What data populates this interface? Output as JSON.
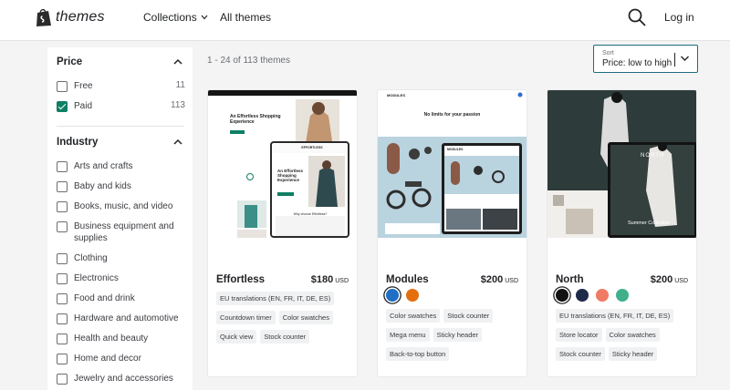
{
  "header": {
    "brand": "themes",
    "nav": {
      "collections": "Collections",
      "all_themes": "All themes"
    },
    "login": "Log in"
  },
  "sidebar": {
    "price": {
      "title": "Price",
      "items": [
        {
          "label": "Free",
          "count": "11",
          "checked": false
        },
        {
          "label": "Paid",
          "count": "113",
          "checked": true
        }
      ]
    },
    "industry": {
      "title": "Industry",
      "items": [
        {
          "label": "Arts and crafts"
        },
        {
          "label": "Baby and kids"
        },
        {
          "label": "Books, music, and video"
        },
        {
          "label": "Business equipment and supplies"
        },
        {
          "label": "Clothing"
        },
        {
          "label": "Electronics"
        },
        {
          "label": "Food and drink"
        },
        {
          "label": "Hardware and automotive"
        },
        {
          "label": "Health and beauty"
        },
        {
          "label": "Home and decor"
        },
        {
          "label": "Jewelry and accessories"
        }
      ]
    }
  },
  "results": {
    "count_text": "1 - 24 of 113 themes",
    "sort": {
      "caption": "Sort",
      "value": "Price: low to high"
    }
  },
  "themes": [
    {
      "name": "Effortless",
      "price": "$180",
      "currency": "USD",
      "preview_text": {
        "hero": "An Effortless Shopping Experience",
        "logo": "EFFORTLESS",
        "section": "Why choose Effortless?"
      },
      "tags": [
        "EU translations (EN, FR, IT, DE, ES)",
        "Countdown timer",
        "Color swatches",
        "Quick view",
        "Stock counter"
      ]
    },
    {
      "name": "Modules",
      "price": "$200",
      "currency": "USD",
      "preview_text": {
        "hero": "No limits for your passion",
        "logo": "MODULES"
      },
      "swatches": [
        {
          "color": "#1f6fc5",
          "selected": true
        },
        {
          "color": "#e36f0f",
          "selected": false
        }
      ],
      "tags": [
        "Color swatches",
        "Stock counter",
        "Mega menu",
        "Sticky header",
        "Back-to-top button"
      ]
    },
    {
      "name": "North",
      "price": "$200",
      "currency": "USD",
      "preview_text": {
        "hero": "Summer Collection",
        "logo": "NORTH"
      },
      "swatches": [
        {
          "color": "#111111",
          "selected": true
        },
        {
          "color": "#1d2a4a",
          "selected": false
        },
        {
          "color": "#f07a63",
          "selected": false
        },
        {
          "color": "#3fb08a",
          "selected": false
        }
      ],
      "tags": [
        "EU translations (EN, FR, IT, DE, ES)",
        "Store locator",
        "Color swatches",
        "Stock counter",
        "Sticky header"
      ]
    }
  ]
}
